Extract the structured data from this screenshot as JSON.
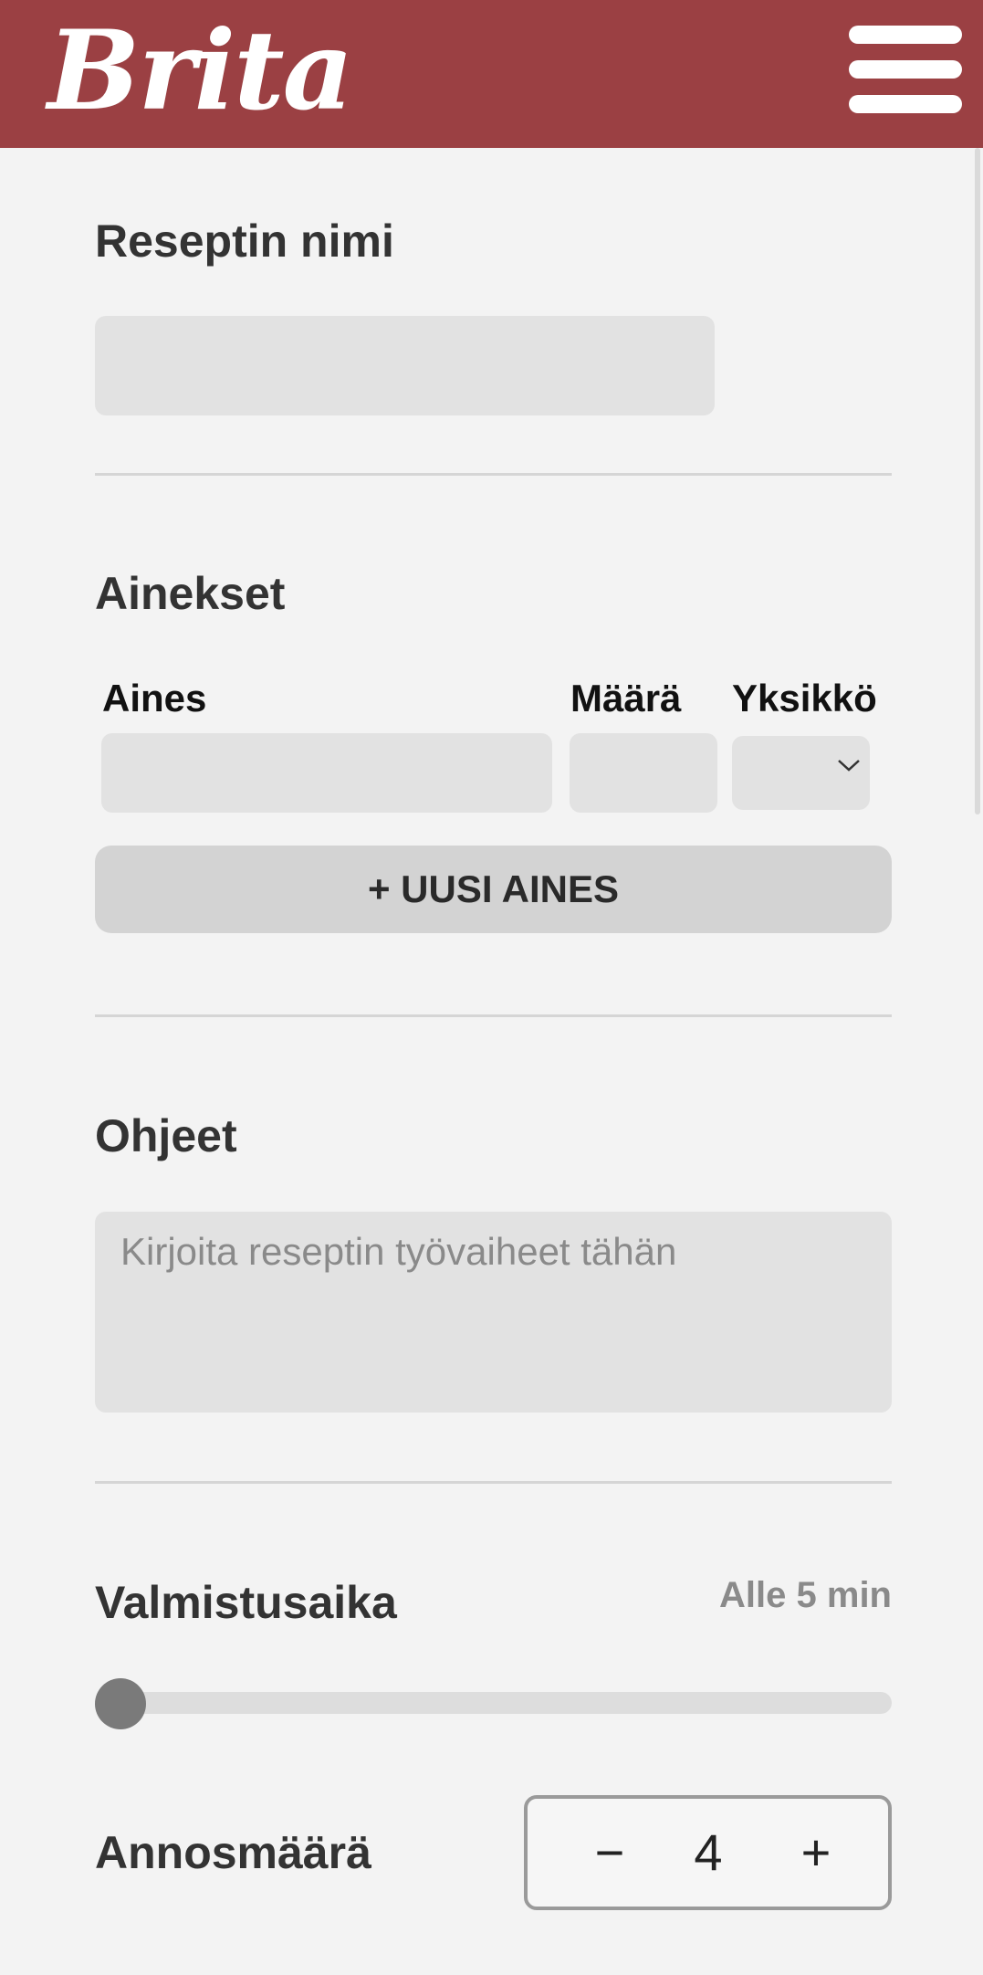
{
  "header": {
    "logo_text": "Brita",
    "menu_icon": "hamburger-menu-icon",
    "background_color": "#9b4043"
  },
  "recipe_name": {
    "title": "Reseptin nimi",
    "value": ""
  },
  "ingredients": {
    "title": "Ainekset",
    "columns": {
      "ingredient": "Aines",
      "amount": "Määrä",
      "unit": "Yksikkö"
    },
    "row": {
      "ingredient": "",
      "amount": "",
      "unit": ""
    },
    "unit_chevron_icon": "chevron-down-icon",
    "add_button_label": "+ UUSI AINES"
  },
  "instructions": {
    "title": "Ohjeet",
    "placeholder": "Kirjoita reseptin työvaiheet tähän"
  },
  "prep_time": {
    "title": "Valmistusaika",
    "value_label": "Alle 5 min",
    "slider_level": 0
  },
  "servings": {
    "title": "Annosmäärä",
    "decrement_label": "−",
    "value": "4",
    "increment_label": "+"
  }
}
